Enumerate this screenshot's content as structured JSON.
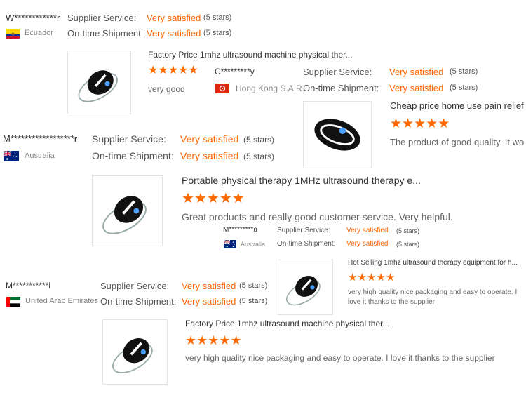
{
  "colors": {
    "accent": "#ff6600",
    "star": "#ff6a00",
    "border": "#e3e3e3"
  },
  "reviews": [
    {
      "buyer": "W************r",
      "country": "Ecuador",
      "flag": "ecuador-flag-icon",
      "supplier_label": "Supplier Service:",
      "supplier_value": "Very satisfied",
      "supplier_stars": "(5 stars)",
      "shipment_label": "On-time Shipment:",
      "shipment_value": "Very satisfied",
      "shipment_stars": "(5 stars)",
      "product_title": "Factory Price 1mhz ultrasound machine physical ther...",
      "rating": 5,
      "comment": "very good"
    },
    {
      "buyer": "C*********y",
      "country": "Hong Kong S.A.R.",
      "flag": "hong-kong-flag-icon",
      "supplier_label": "Supplier Service:",
      "supplier_value": "Very satisfied",
      "supplier_stars": "(5 stars)",
      "shipment_label": "On-time Shipment:",
      "shipment_value": "Very satisfied",
      "shipment_stars": "(5 stars)",
      "product_title": "Cheap price home use pain relief",
      "rating": 5,
      "comment": "The product of good quality. It wo"
    },
    {
      "buyer": "M******************r",
      "country": "Australia",
      "flag": "australia-flag-icon",
      "supplier_label": "Supplier Service:",
      "supplier_value": "Very satisfied",
      "supplier_stars": "(5 stars)",
      "shipment_label": "On-time Shipment:",
      "shipment_value": "Very satisfied",
      "shipment_stars": "(5 stars)",
      "product_title": "Portable physical therapy 1MHz ultrasound therapy e...",
      "rating": 5,
      "comment": "Great products and really good customer service. Very helpful."
    },
    {
      "buyer": "M*********a",
      "country": "Australia",
      "flag": "australia-flag-icon",
      "supplier_label": "Supplier Service:",
      "supplier_value": "Very satisfied",
      "supplier_stars": "(5 stars)",
      "shipment_label": "On-time Shipment:",
      "shipment_value": "Very satisfied",
      "shipment_stars": "(5 stars)",
      "product_title": "Hot Selling 1mhz ultrasound therapy equipment for h...",
      "rating": 5,
      "comment": "very high quality nice packaging and easy to operate. I love it thanks to the supplier"
    },
    {
      "buyer": "M***********l",
      "country": "United Arab Emirates",
      "flag": "uae-flag-icon",
      "supplier_label": "Supplier Service:",
      "supplier_value": "Very satisfied",
      "supplier_stars": "(5 stars)",
      "shipment_label": "On-time Shipment:",
      "shipment_value": "Very satisfied",
      "shipment_stars": "(5 stars)",
      "product_title": "Factory Price 1mhz ultrasound machine physical ther...",
      "rating": 5,
      "comment": "very high quality nice packaging and easy to operate. I love it thanks to the supplier"
    }
  ]
}
